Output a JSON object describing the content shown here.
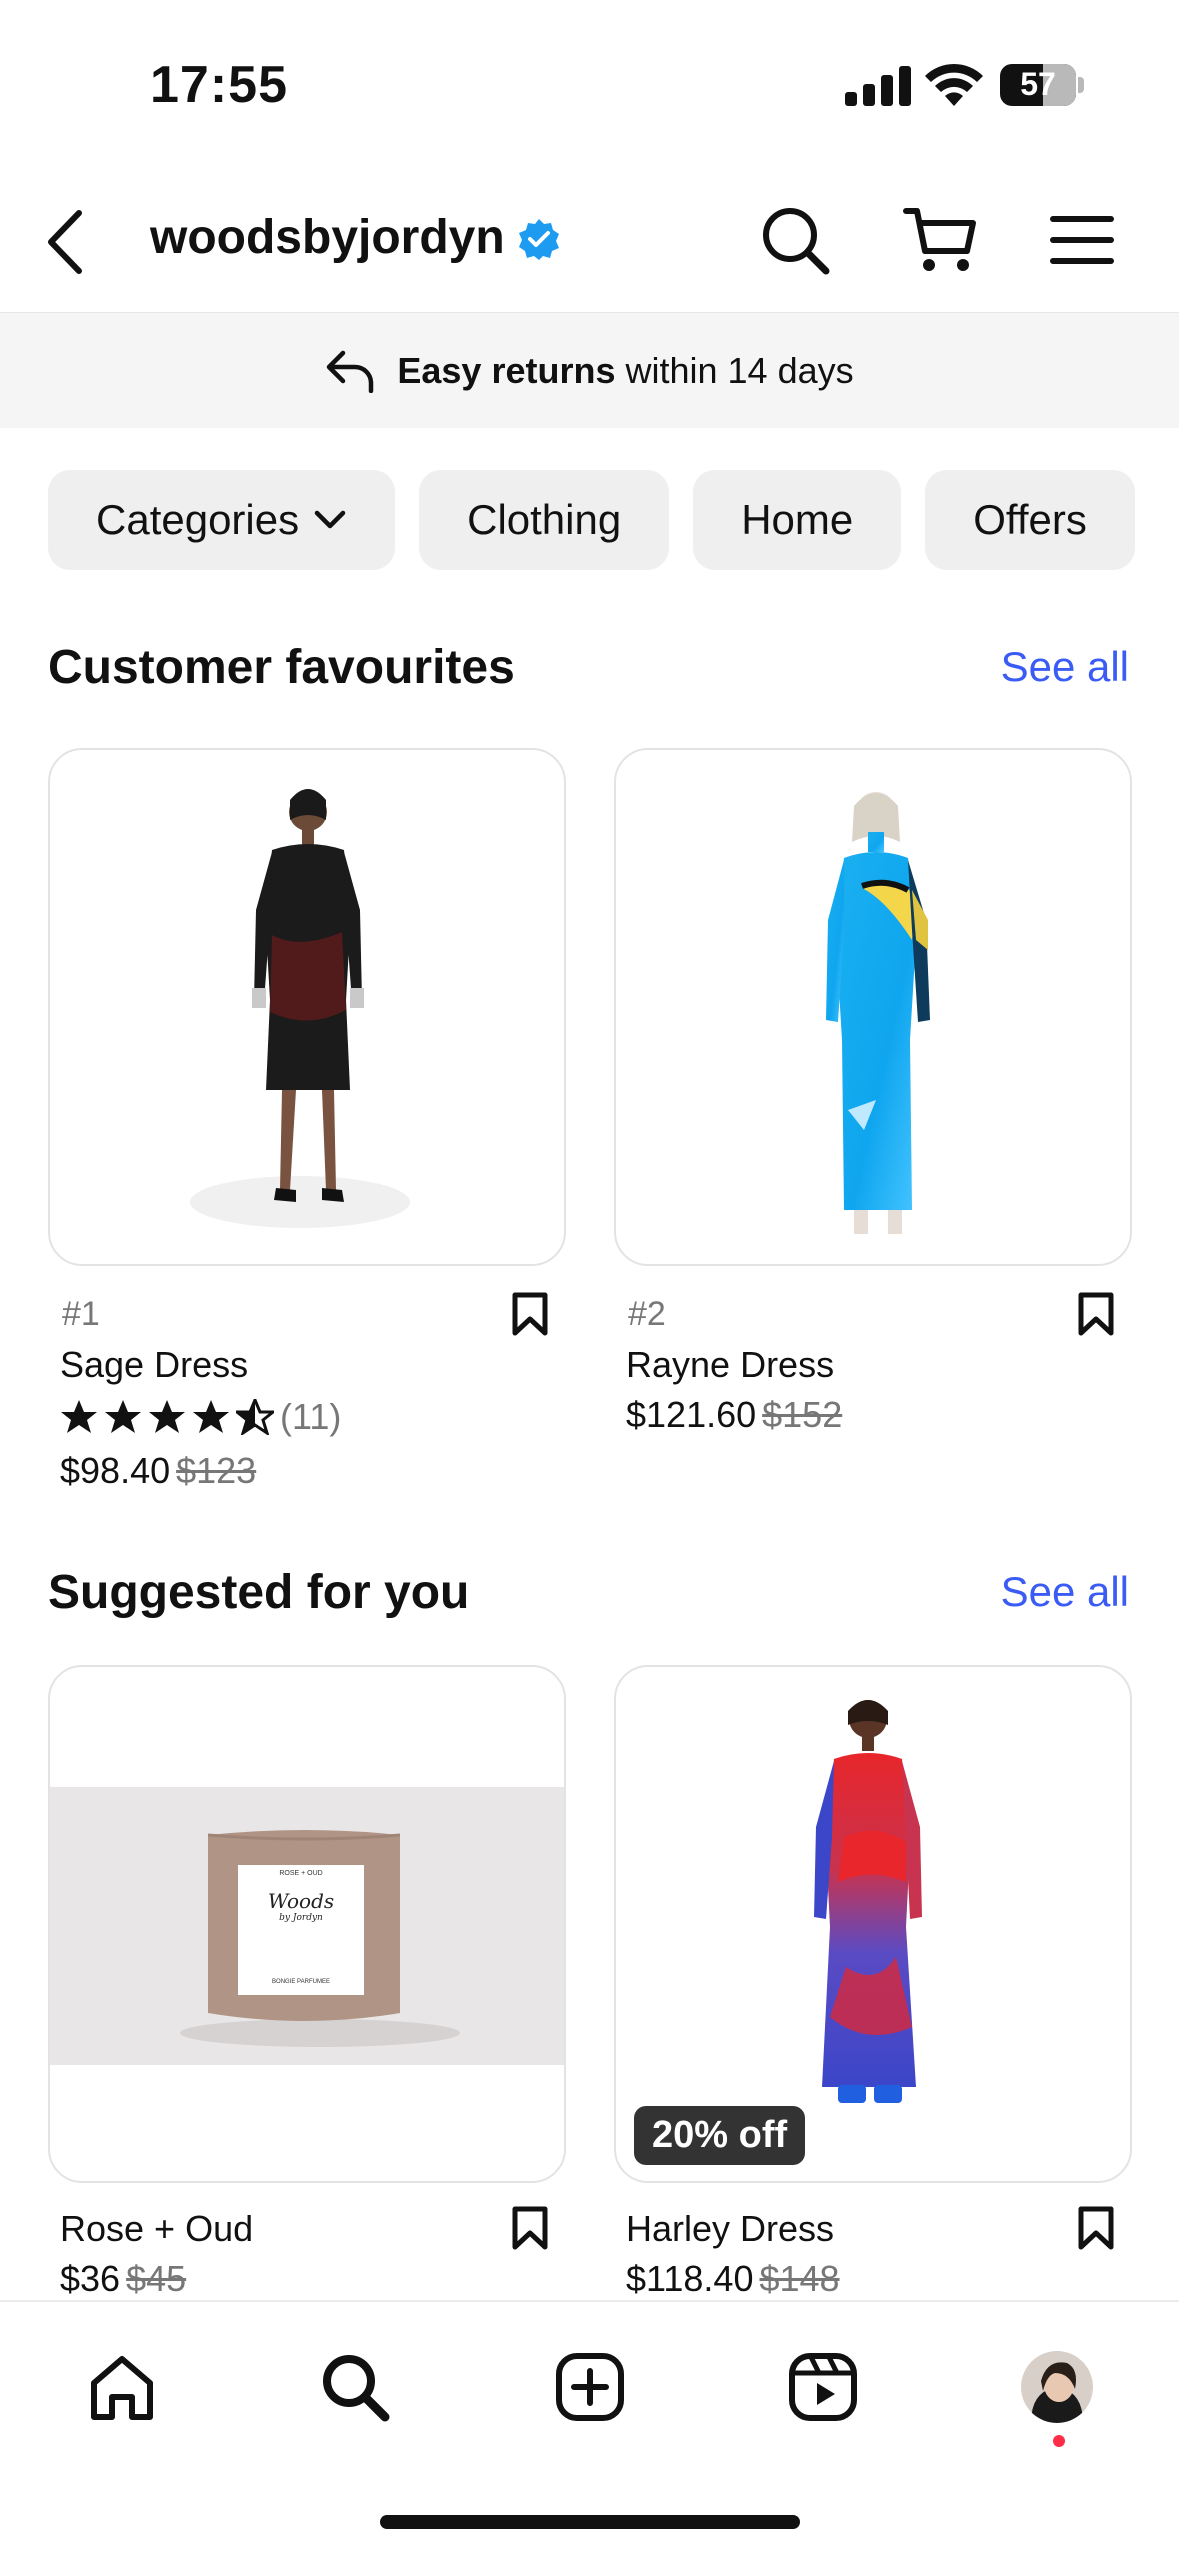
{
  "status_bar": {
    "time": "17:55",
    "battery": "57"
  },
  "header": {
    "shop_name": "woodsbyjordyn"
  },
  "banner": {
    "bold": "Easy returns",
    "rest": " within 14 days"
  },
  "chips": [
    {
      "label": "Categories"
    },
    {
      "label": "Clothing"
    },
    {
      "label": "Home"
    },
    {
      "label": "Offers"
    }
  ],
  "sections": {
    "favourites": {
      "title": "Customer favourites",
      "see_all": "See all",
      "products": [
        {
          "rank": "#1",
          "name": "Sage Dress",
          "rating_count": "(11)",
          "rating": 4.5,
          "price": "$98.40",
          "old_price": "$123"
        },
        {
          "rank": "#2",
          "name": "Rayne Dress",
          "price": "$121.60",
          "old_price": "$152"
        }
      ]
    },
    "suggested": {
      "title": "Suggested for you",
      "see_all": "See all",
      "products": [
        {
          "name": "Rose + Oud",
          "price": "$36",
          "old_price": "$45"
        },
        {
          "name": "Harley Dress",
          "price": "$118.40",
          "old_price": "$148",
          "badge": "20% off"
        }
      ]
    }
  },
  "candle_label": {
    "top": "ROSE + OUD",
    "brand": "Woods",
    "sub": "by Jordyn",
    "bottom": "BONGIE PARFUMEE"
  },
  "bottom_nav": [
    "home-icon",
    "search-icon",
    "create-icon",
    "reels-icon",
    "profile-avatar"
  ],
  "colors": {
    "accent": "#3a5cf5",
    "verified": "#1d9bf0",
    "notification": "#ff2d48"
  }
}
